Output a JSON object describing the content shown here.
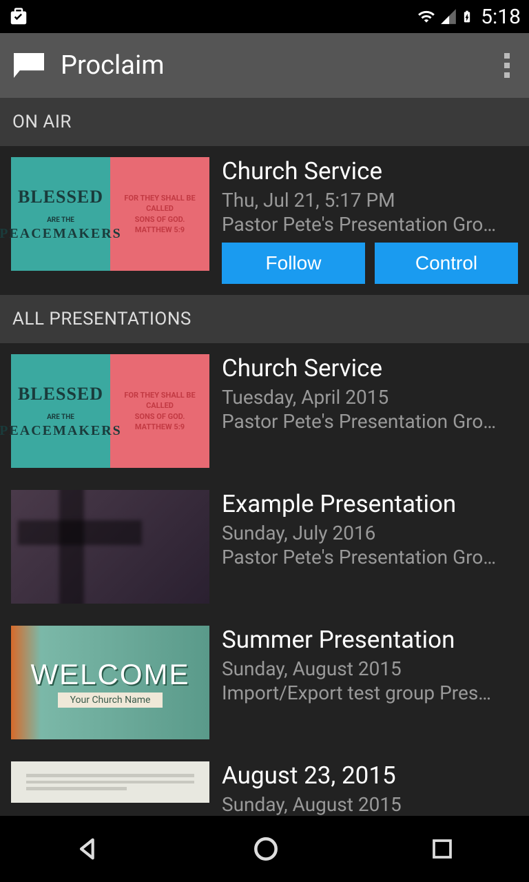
{
  "status": {
    "time": "5:18"
  },
  "header": {
    "title": "Proclaim"
  },
  "sections": {
    "onair_label": "ON AIR",
    "all_label": "ALL PRESENTATIONS"
  },
  "onair": {
    "title": "Church Service",
    "subtitle": "Thu, Jul 21, 5:17 PM",
    "group": "Pastor Pete's Presentation Gro…",
    "follow_label": "Follow",
    "control_label": "Control"
  },
  "presentations": [
    {
      "title": "Church Service",
      "subtitle": "Tuesday, April 2015",
      "group": "Pastor Pete's Presentation Gro…"
    },
    {
      "title": "Example Presentation",
      "subtitle": "Sunday, July 2016",
      "group": "Pastor Pete's Presentation Gro…"
    },
    {
      "title": "Summer Presentation",
      "subtitle": "Sunday, August 2015",
      "group": "Import/Export test group Pres…"
    },
    {
      "title": "August 23, 2015",
      "subtitle": "Sunday, August 2015",
      "group": ""
    }
  ],
  "thumb_text": {
    "blessed_l1": "BLESSED",
    "blessed_l2": "ARE THE",
    "blessed_l3": "PEACEMAKERS",
    "blessed_r1": "FOR THEY SHALL BE CALLED",
    "blessed_r2": "SONS OF GOD.",
    "blessed_r3": "MATTHEW 5:9",
    "welcome_l1": "WELCOME",
    "welcome_l2": "Your Church Name"
  }
}
